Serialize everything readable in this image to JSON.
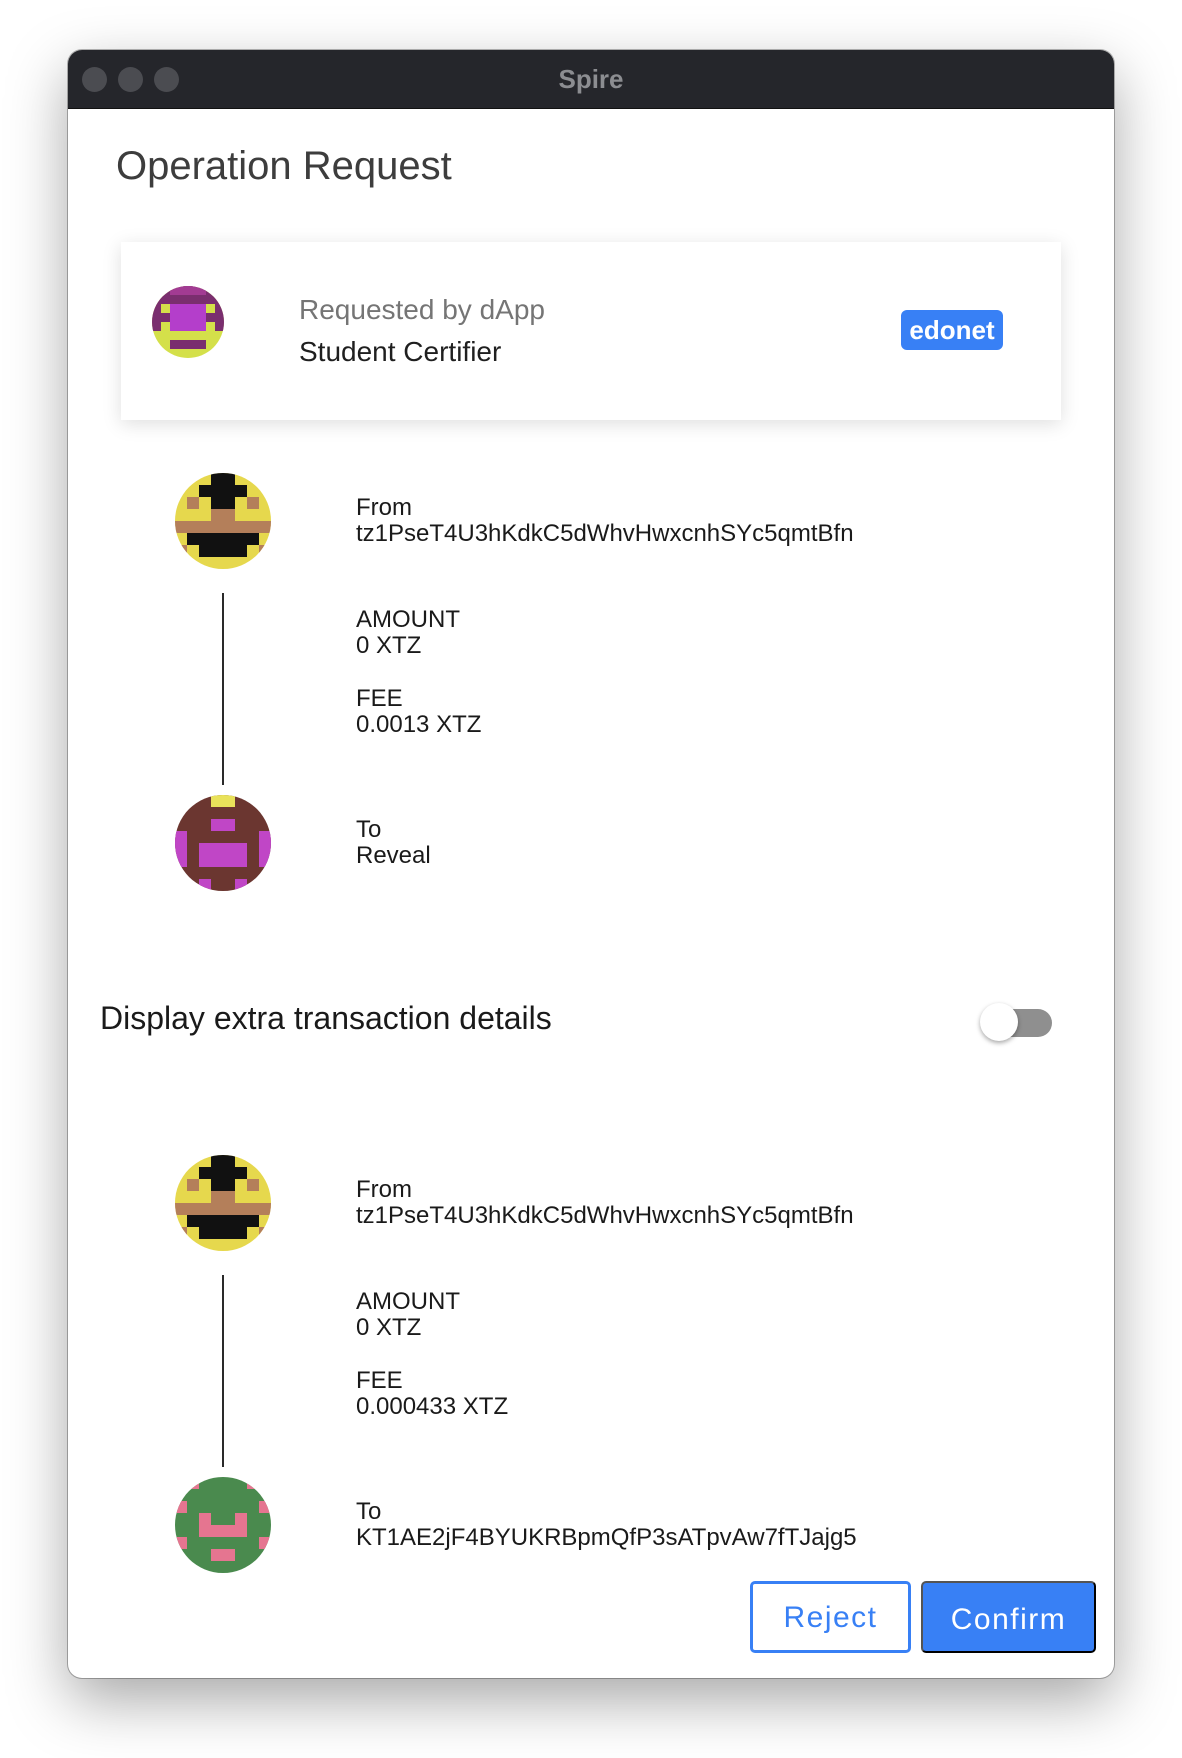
{
  "window": {
    "title": "Spire",
    "controls": [
      "close",
      "minimize",
      "zoom"
    ]
  },
  "page": {
    "title": "Operation Request"
  },
  "dapp": {
    "subtitle": "Requested by dApp",
    "name": "Student Certifier",
    "network": "edonet"
  },
  "operations": [
    {
      "from_label": "From",
      "from_value": "tz1PseT4U3hKdkC5dWhvHwxcnhSYc5qmtBfn",
      "amount_label": "AMOUNT",
      "amount_value": "0 XTZ",
      "fee_label": "FEE",
      "fee_value": "0.0013 XTZ",
      "to_label": "To",
      "to_value": "Reveal"
    },
    {
      "from_label": "From",
      "from_value": "tz1PseT4U3hKdkC5dWhvHwxcnhSYc5qmtBfn",
      "amount_label": "AMOUNT",
      "amount_value": "0 XTZ",
      "fee_label": "FEE",
      "fee_value": "0.000433 XTZ",
      "to_label": "To",
      "to_value": "KT1AE2jF4BYUKRBpmQfP3sATpvAw7fTJajg5"
    }
  ],
  "details_toggle": {
    "label": "Display extra transaction details",
    "state": "off"
  },
  "actions": {
    "reject_label": "Reject",
    "confirm_label": "Confirm"
  },
  "colors": {
    "accent": "#3880f5",
    "titlebar": "#25262b"
  },
  "icons": [
    "dapp-identicon-icon",
    "from-identicon-icon",
    "to-identicon-icon"
  ]
}
